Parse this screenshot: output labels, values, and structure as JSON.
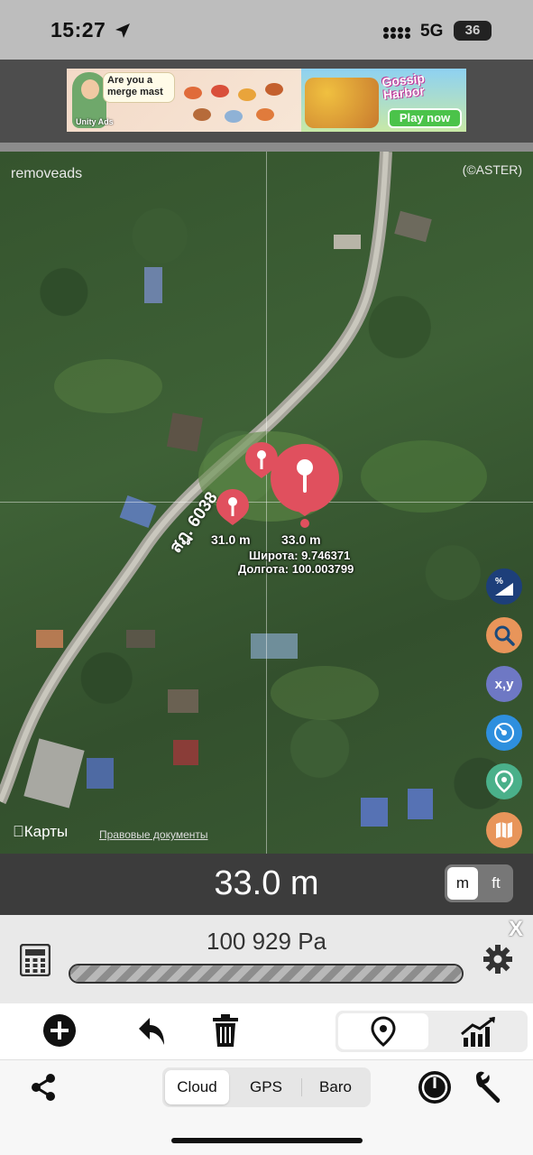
{
  "status_bar": {
    "time": "15:27",
    "network": "5G",
    "battery": "36"
  },
  "ad": {
    "bubble_text": "Are you a merge mast",
    "provider": "Unity Ads",
    "game_title": "Gossip Harbor",
    "play_label": "Play now"
  },
  "map": {
    "remove_ads": "removeads",
    "attribution": "(©ASTER)",
    "road_label": "สฎ. 6038",
    "pin_small_label": "31.0 m",
    "pin_large_label": "33.0 m",
    "latitude": "Широта: 9.746371",
    "longitude": "Долгота: 100.003799",
    "apple_maps": "Карты",
    "legal": "Правовые документы",
    "side_buttons": [
      {
        "icon": "percent-slope-icon",
        "text": "%",
        "color": "#1d3f7a"
      },
      {
        "icon": "search-icon",
        "text": "",
        "color": "#e8955a"
      },
      {
        "icon": "xy-coordinates-icon",
        "text": "x,y",
        "color": "#6e78c4"
      },
      {
        "icon": "compass-icon",
        "text": "",
        "color": "#2e8fde"
      },
      {
        "icon": "location-pin-icon",
        "text": "",
        "color": "#4ab08a"
      },
      {
        "icon": "map-icon",
        "text": "",
        "color": "#e8955a"
      }
    ]
  },
  "altitude": {
    "value": "33.0 m",
    "unit_m": "m",
    "unit_ft": "ft",
    "selected_unit": "m"
  },
  "pressure": {
    "value": "100 929 Pa",
    "progress": 1.0,
    "close": "X"
  },
  "toolbar": {
    "icons": [
      "add-icon",
      "undo-icon",
      "trash-icon"
    ],
    "view_segments": [
      "location-pin-icon",
      "chart-icon"
    ],
    "selected_view": "location-pin-icon"
  },
  "source_segment": {
    "options": [
      "Cloud",
      "GPS",
      "Baro"
    ],
    "selected": "Cloud"
  }
}
